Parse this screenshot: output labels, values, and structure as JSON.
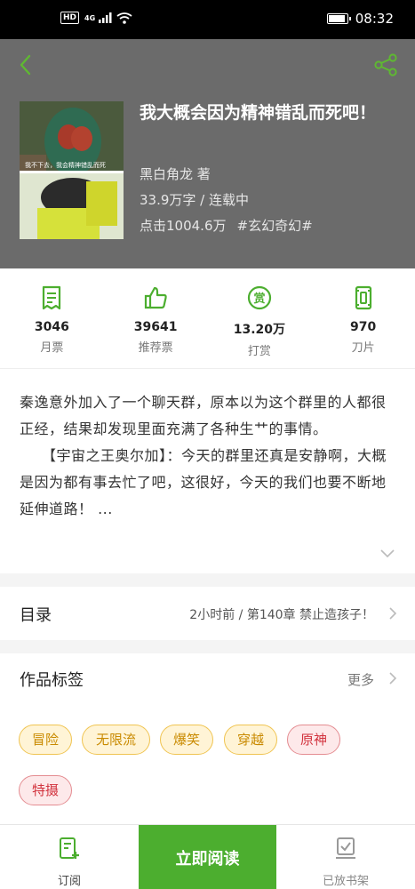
{
  "status_bar": {
    "hd": "HD",
    "network": "4G",
    "time": "08:32",
    "battery_level": 0.85
  },
  "book": {
    "title": "我大概会因为精神错乱而死吧！",
    "author": "黑白角龙  著",
    "wordcount_status": "33.9万字 / 连载中",
    "clicks": "点击1004.6万",
    "genre_tag": "#玄幻奇幻#",
    "cover_caption": "我不下去，我会精神错乱而死"
  },
  "stats": [
    {
      "icon": "monthly-ticket-icon",
      "value": "3046",
      "label": "月票"
    },
    {
      "icon": "thumbs-up-icon",
      "value": "39641",
      "label": "推荐票"
    },
    {
      "icon": "reward-icon",
      "value": "13.20万",
      "label": "打赏"
    },
    {
      "icon": "blade-icon",
      "value": "970",
      "label": "刀片"
    }
  ],
  "synopsis": {
    "p1": "秦逸意外加入了一个聊天群，原本以为这个群里的人都很正经，结果却发现里面充满了各种生艹的事情。",
    "p2": "　　【宇宙之王奥尔加】：今天的群里还真是安静啊，大概是因为都有事去忙了吧，这很好，今天的我们也要不断地延伸道路！ ..."
  },
  "toc": {
    "title": "目录",
    "latest": "2小时前 / 第140章 禁止造孩子！"
  },
  "tags_section": {
    "title": "作品标签",
    "more": "更多",
    "tags": [
      {
        "label": "冒险",
        "color": "yellow"
      },
      {
        "label": "无限流",
        "color": "yellow"
      },
      {
        "label": "爆笑",
        "color": "yellow"
      },
      {
        "label": "穿越",
        "color": "yellow"
      },
      {
        "label": "原神",
        "color": "red"
      },
      {
        "label": "特摄",
        "color": "red"
      }
    ]
  },
  "bottom_bar": {
    "subscribe": "订阅",
    "read_now": "立即阅读",
    "on_shelf": "已放书架"
  },
  "colors": {
    "accent": "#4cae2f",
    "header_bg": "#6b6b6b"
  }
}
